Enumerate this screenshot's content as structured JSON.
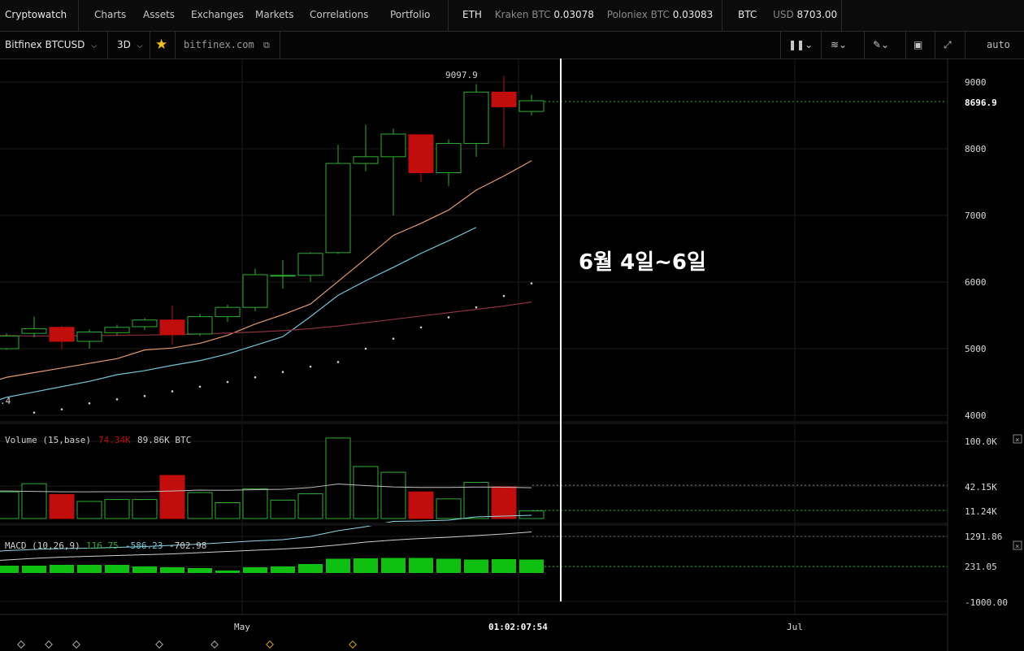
{
  "topbar": {
    "brand": "Cryptowatch",
    "nav": [
      "Charts",
      "Assets",
      "Exchanges",
      "Markets",
      "Correlations",
      "Portfolio"
    ],
    "ticker1": {
      "symbol": "ETH",
      "m1_label": "Kraken BTC",
      "m1_value": "0.03078",
      "m2_label": "Poloniex BTC",
      "m2_value": "0.03083"
    },
    "ticker2": {
      "symbol": "BTC",
      "label": "USD",
      "value": "8703.00"
    }
  },
  "toolbar": {
    "market": "Bitfinex BTCUSD",
    "period": "3D",
    "exchange_link": "bitfinex.com",
    "scale_mode": "auto"
  },
  "price_pane": {
    "high_label": "9097.9",
    "last_price": "8696.9",
    "left_cut_label": ".4",
    "y_ticks": [
      "9000",
      "8000",
      "7000",
      "6000",
      "5000",
      "4000"
    ]
  },
  "volume_pane": {
    "title": "Volume (15,base)",
    "value_red": "74.34K",
    "value_white": "89.86K BTC",
    "y_ticks": [
      "100.0K",
      "42.15K",
      "11.24K"
    ]
  },
  "macd_pane": {
    "title": "MACD (10,26,9)",
    "v1": "116.75",
    "v2": "-586.23",
    "v3": "-702.98",
    "y_ticks": [
      "1291.86",
      "231.05",
      "-1000.00"
    ]
  },
  "time_axis": {
    "labels": [
      "May",
      "01:02:07:54",
      "Jul"
    ]
  },
  "annotation": {
    "text": "6월 4일~6일"
  },
  "colors": {
    "up": "#2fae2f",
    "down": "#c20d0d",
    "ema_fast": "#e09a6a",
    "ema_mid": "#6fc6d6",
    "ema_slow": "#8a3040",
    "macd_hist": "#10c010",
    "annotation": "#ffffff"
  },
  "chart_data": {
    "type": "candlestick",
    "series": [
      {
        "name": "price",
        "candles": [
          {
            "o": 5000,
            "h": 5230,
            "l": 4980,
            "c": 5190
          },
          {
            "o": 5230,
            "h": 5480,
            "l": 5170,
            "c": 5300
          },
          {
            "o": 5320,
            "h": 5340,
            "l": 4990,
            "c": 5110
          },
          {
            "o": 5110,
            "h": 5290,
            "l": 5000,
            "c": 5250
          },
          {
            "o": 5240,
            "h": 5360,
            "l": 5200,
            "c": 5320
          },
          {
            "o": 5330,
            "h": 5460,
            "l": 5280,
            "c": 5430
          },
          {
            "o": 5430,
            "h": 5650,
            "l": 5060,
            "c": 5210
          },
          {
            "o": 5220,
            "h": 5520,
            "l": 5190,
            "c": 5480
          },
          {
            "o": 5480,
            "h": 5660,
            "l": 5400,
            "c": 5620
          },
          {
            "o": 5620,
            "h": 6200,
            "l": 5560,
            "c": 6110
          },
          {
            "o": 6100,
            "h": 6330,
            "l": 5900,
            "c": 6100
          },
          {
            "o": 6100,
            "h": 6450,
            "l": 6000,
            "c": 6430
          },
          {
            "o": 6440,
            "h": 8060,
            "l": 6420,
            "c": 7780
          },
          {
            "o": 7780,
            "h": 8360,
            "l": 7660,
            "c": 7880
          },
          {
            "o": 7880,
            "h": 8300,
            "l": 7000,
            "c": 8220
          },
          {
            "o": 8210,
            "h": 8210,
            "l": 7500,
            "c": 7640
          },
          {
            "o": 7640,
            "h": 8140,
            "l": 7440,
            "c": 8080
          },
          {
            "o": 8080,
            "h": 8970,
            "l": 7880,
            "c": 8850
          },
          {
            "o": 8850,
            "h": 9097.9,
            "l": 8020,
            "c": 8630
          },
          {
            "o": 8560,
            "h": 8810,
            "l": 8500,
            "c": 8720
          }
        ]
      },
      {
        "name": "ema_fast",
        "values": [
          4450,
          4570,
          4640,
          4710,
          4780,
          4850,
          4980,
          5010,
          5080,
          5200,
          5370,
          5510,
          5670,
          6010,
          6350,
          6700,
          6880,
          7080,
          7380,
          7590,
          7820
        ]
      },
      {
        "name": "ema_mid",
        "values": [
          4130,
          4270,
          4350,
          4430,
          4510,
          4610,
          4670,
          4750,
          4820,
          4920,
          5050,
          5180,
          5480,
          5800,
          6020,
          6220,
          6430,
          6620,
          6820
        ]
      },
      {
        "name": "ema_slow",
        "values": [
          5200,
          5195,
          5190,
          5190,
          5195,
          5200,
          5205,
          5210,
          5220,
          5235,
          5250,
          5270,
          5300,
          5340,
          5390,
          5440,
          5490,
          5540,
          5590,
          5640,
          5700
        ]
      },
      {
        "name": "dots",
        "values": [
          4040,
          4090,
          4180,
          4240,
          4290,
          4360,
          4430,
          4500,
          4570,
          4650,
          4730,
          4800,
          5000,
          5150,
          5320,
          5470,
          5620,
          5790,
          5980
        ]
      }
    ],
    "volume": [
      42,
      55,
      38,
      27,
      30,
      30,
      68,
      41,
      25,
      47,
      29,
      39,
      127,
      82,
      73,
      42,
      31,
      57,
      50,
      12
    ],
    "volume_ma": [
      43,
      43.5,
      42.8,
      42.2,
      42.2,
      42.3,
      42.3,
      43.5,
      44.8,
      44.6,
      45.5,
      46.1,
      48.8,
      54.5,
      52,
      49.8,
      49,
      49,
      49.6,
      49.3,
      48.6
    ],
    "macd_hist": [
      180,
      180,
      200,
      200,
      200,
      160,
      140,
      120,
      60,
      140,
      160,
      220,
      350,
      360,
      370,
      370,
      350,
      330,
      340,
      330
    ],
    "macd_line": [
      -20,
      30,
      60,
      80,
      90,
      110,
      130,
      160,
      190,
      230,
      270,
      300,
      380,
      520,
      620,
      750,
      760,
      780,
      860,
      880,
      900
    ],
    "signal_line": [
      -70,
      -40,
      0,
      30,
      50,
      70,
      90,
      110,
      140,
      170,
      200,
      230,
      270,
      330,
      400,
      450,
      490,
      520,
      560,
      600,
      650
    ],
    "ylim": [
      4000,
      9200
    ]
  }
}
